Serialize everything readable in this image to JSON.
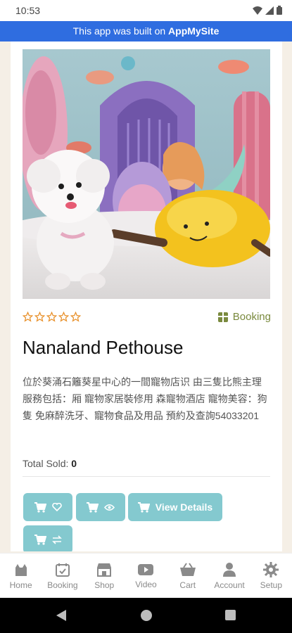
{
  "status": {
    "time": "10:53"
  },
  "banner": {
    "prefix": "This app was built on ",
    "brand": "AppMySite"
  },
  "product": {
    "rating_stars": 5,
    "booking_label": "Booking",
    "title": "Nanaland Pethouse",
    "description": "位於葵涌石籬葵星中心的一間寵物店识 由三隻比熊主理 服務包括：厢 寵物家居裝修用 森寵物酒店 寵物美容：狗隻 免麻醉洗牙、寵物食品及用品 預約及查詢54033201",
    "total_sold_label": "Total Sold:",
    "total_sold_value": "0"
  },
  "actions": {
    "view_details_label": "View Details"
  },
  "nav": {
    "items": [
      {
        "label": "Home",
        "icon": "cat-icon"
      },
      {
        "label": "Booking",
        "icon": "calendar-check-icon"
      },
      {
        "label": "Shop",
        "icon": "store-icon"
      },
      {
        "label": "Video",
        "icon": "video-icon"
      },
      {
        "label": "Cart",
        "icon": "basket-icon"
      },
      {
        "label": "Account",
        "icon": "user-icon"
      },
      {
        "label": "Setup",
        "icon": "gear-icon"
      }
    ]
  },
  "colors": {
    "banner": "#2f6de0",
    "action_buttons": "#84c9cf",
    "star_outline": "#e8902a",
    "booking_tag": "#7a8a3e"
  }
}
